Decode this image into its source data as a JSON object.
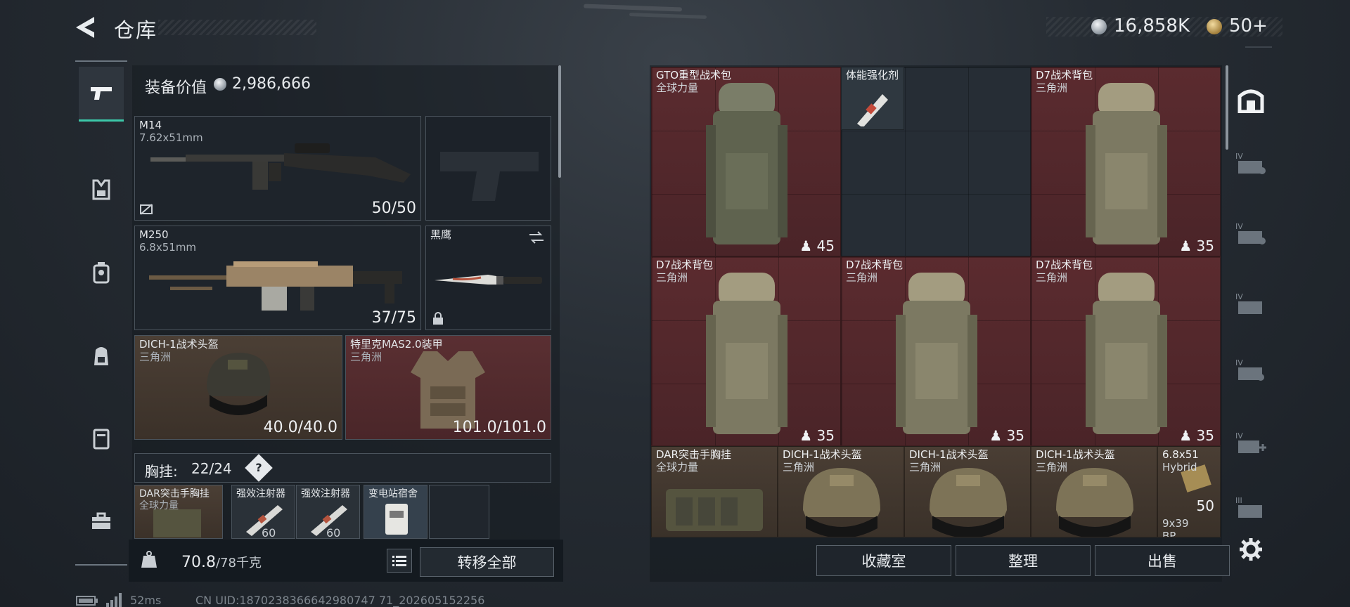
{
  "header": {
    "title": "仓库",
    "currency_silver": "16,858K",
    "currency_gold": "50+"
  },
  "rail": {
    "items": [
      {
        "icon": "pistol-icon",
        "active": true
      },
      {
        "icon": "vest-icon"
      },
      {
        "icon": "helmet-icon"
      },
      {
        "icon": "backpack-icon"
      },
      {
        "icon": "pouch-icon"
      },
      {
        "icon": "toolbox-icon"
      }
    ]
  },
  "loadout": {
    "equip_value_label": "装备价值",
    "equip_value": "2,986,666",
    "primary": {
      "name": "M14",
      "caliber": "7.62x51mm",
      "ammo": "50/50"
    },
    "secondary": {
      "name": "M250",
      "caliber": "6.8x51mm",
      "ammo": "37/75"
    },
    "melee": {
      "name": "黑鹰"
    },
    "helmet": {
      "name": "DICH-1战术头盔",
      "sub": "三角洲",
      "durability": "40.0/40.0"
    },
    "armor": {
      "name": "特里克MAS2.0装甲",
      "sub": "三角洲",
      "durability": "101.0/101.0"
    },
    "rig_label": "胸挂:",
    "rig_count": "22/24",
    "rig_help": "?",
    "rig_items": [
      {
        "name": "DAR突击手胸挂",
        "sub": "全球力量"
      },
      {
        "name": "强效注射器",
        "num": "60"
      },
      {
        "name": "强效注射器",
        "num": "60"
      },
      {
        "name": "变电站宿舍"
      }
    ],
    "weight": "70.8",
    "weight_max": "/78千克",
    "transfer_all": "转移全部"
  },
  "stash": {
    "items": [
      {
        "name": "GTO重型战术包",
        "sub": "全球力量",
        "count": "45"
      },
      {
        "name": "体能强化剂"
      },
      {
        "name": "D7战术背包",
        "sub": "三角洲",
        "count": "35"
      },
      {
        "name": "D7战术背包",
        "sub": "三角洲",
        "count": "35"
      },
      {
        "name": "D7战术背包",
        "sub": "三角洲",
        "count": "35"
      },
      {
        "name": "D7战术背包",
        "sub": "三角洲",
        "count": "35"
      },
      {
        "name": "DAR突击手胸挂",
        "sub": "全球力量"
      },
      {
        "name": "DICH-1战术头盔",
        "sub": "三角洲"
      },
      {
        "name": "DICH-1战术头盔",
        "sub": "三角洲"
      },
      {
        "name": "DICH-1战术头盔",
        "sub": "三角洲"
      },
      {
        "name": "6.8x51",
        "sub": "Hybrid",
        "qty": "50",
        "next": "9x39",
        "next_sub": "BP"
      }
    ],
    "buttons": {
      "collection": "收藏室",
      "sort": "整理",
      "sell": "出售"
    }
  },
  "right_rail": {
    "items": [
      "safehouse-icon",
      "tier-iv-container-icon",
      "tier-iv-container-icon",
      "tier-iv-container-icon",
      "tier-iv-container-icon",
      "tier-iv-add-container-icon",
      "tier-iii-container-icon",
      "settings-gear-icon"
    ]
  },
  "footer": {
    "ping": "52ms",
    "uid": "CN UID:1870238366642980747 71_202605152256"
  },
  "colors": {
    "accent": "#3cc8a9",
    "red_rarity": "#5a2f32",
    "brown_rarity": "#4b3f35"
  }
}
